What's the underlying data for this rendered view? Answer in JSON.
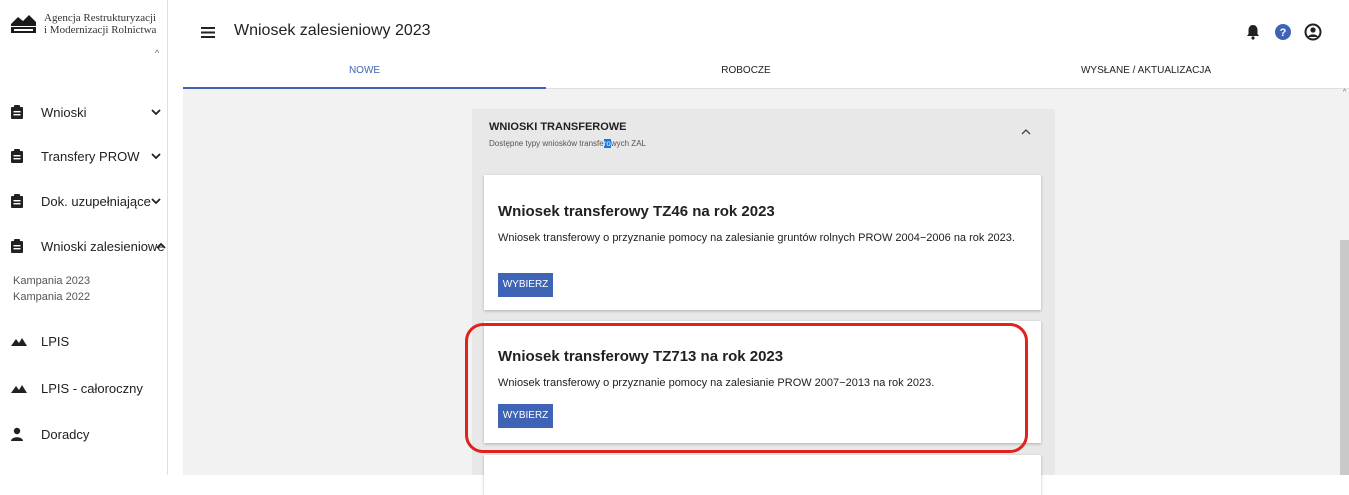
{
  "app": {
    "logo_line1": "Agencja Restrukturyzacji",
    "logo_line2": "i Modernizacji Rolnictwa",
    "page_title": "Wniosek zalesieniowy 2023"
  },
  "sidebar": {
    "items": [
      {
        "label": "Wnioski",
        "icon": "clipboard-icon",
        "chevron": "down"
      },
      {
        "label": "Transfery PROW",
        "icon": "clipboard-icon",
        "chevron": "down"
      },
      {
        "label": "Dok. uzupełniające",
        "icon": "clipboard-icon",
        "chevron": "down"
      },
      {
        "label": "Wnioski zalesieniowe",
        "icon": "clipboard-icon",
        "chevron": "up"
      },
      {
        "label": "LPIS",
        "icon": "terrain-icon"
      },
      {
        "label": "LPIS - całoroczny",
        "icon": "terrain-icon"
      },
      {
        "label": "Doradcy",
        "icon": "person-icon"
      }
    ],
    "subitems": [
      "Kampania 2023",
      "Kampania 2022"
    ]
  },
  "tabs": [
    {
      "label": "NOWE",
      "active": true
    },
    {
      "label": "ROBOCZE",
      "active": false
    },
    {
      "label": "WYSŁANE / AKTUALIZACJA",
      "active": false
    }
  ],
  "panel": {
    "title": "WNIOSKI TRANSFEROWE",
    "subtitle_pre": "Dostępne typy wniosków transfe",
    "subtitle_hl": "ro",
    "subtitle_post": "wych ZAL"
  },
  "cards": [
    {
      "title": "Wniosek transferowy TZ46 na rok 2023",
      "description": "Wniosek transferowy o przyznanie pomocy na zalesianie gruntów rolnych PROW 2004−2006 na rok 2023.",
      "button": "WYBIERZ"
    },
    {
      "title": "Wniosek transferowy TZ713 na rok 2023",
      "description": "Wniosek transferowy o przyznanie pomocy na zalesianie PROW 2007−2013 na rok 2023.",
      "button": "WYBIERZ"
    }
  ],
  "colors": {
    "accent": "#3f64b5",
    "highlight_ring": "#e0211c",
    "help_icon": "#3f64b5"
  },
  "header_icons": [
    "bell-icon",
    "help-icon",
    "account-icon"
  ]
}
